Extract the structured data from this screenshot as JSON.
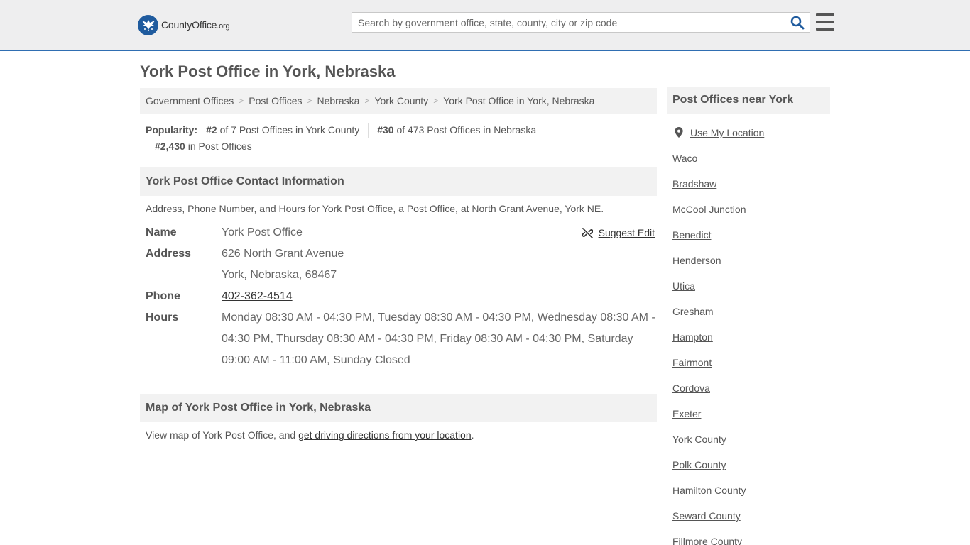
{
  "header": {
    "logo_text_main": "CountyOffice",
    "logo_text_tld": ".org",
    "search_placeholder": "Search by government office, state, county, city or zip code"
  },
  "page_title": "York Post Office in York, Nebraska",
  "breadcrumb": [
    "Government Offices",
    "Post Offices",
    "Nebraska",
    "York County",
    "York Post Office in York, Nebraska"
  ],
  "popularity": {
    "label": "Popularity:",
    "county_rank": "#2",
    "county_text": "of 7 Post Offices in York County",
    "state_rank": "#30",
    "state_text": "of 473 Post Offices in Nebraska",
    "national_rank": "#2,430",
    "national_text": "in Post Offices"
  },
  "contact": {
    "heading": "York Post Office Contact Information",
    "intro": "Address, Phone Number, and Hours for York Post Office, a Post Office, at North Grant Avenue, York NE.",
    "suggest_edit": "Suggest Edit",
    "name_label": "Name",
    "name": "York Post Office",
    "address_label": "Address",
    "address_line1": "626 North Grant Avenue",
    "address_line2": "York, Nebraska, 68467",
    "phone_label": "Phone",
    "phone": "402-362-4514",
    "hours_label": "Hours",
    "hours": "Monday 08:30 AM - 04:30 PM, Tuesday 08:30 AM - 04:30 PM, Wednesday 08:30 AM - 04:30 PM, Thursday 08:30 AM - 04:30 PM, Friday 08:30 AM - 04:30 PM, Saturday 09:00 AM - 11:00 AM, Sunday Closed"
  },
  "map": {
    "heading": "Map of York Post Office in York, Nebraska",
    "intro_before": "View map of York Post Office, and ",
    "intro_link": "get driving directions from your location",
    "intro_after": "."
  },
  "sidebar": {
    "heading": "Post Offices near York",
    "use_location": "Use My Location",
    "items": [
      "Waco",
      "Bradshaw",
      "McCool Junction",
      "Benedict",
      "Henderson",
      "Utica",
      "Gresham",
      "Hampton",
      "Fairmont",
      "Cordova",
      "Exeter",
      "York County",
      "Polk County",
      "Hamilton County",
      "Seward County",
      "Fillmore County"
    ]
  },
  "colors": {
    "accent": "#2f6eb2",
    "logo_blue": "#1f5b9e",
    "header_bg": "#eeeeef",
    "panel_bg": "#f2f2f2"
  },
  "icons": [
    "eagle-seal-icon",
    "search-icon",
    "hamburger-menu-icon",
    "broken-link-edit-icon",
    "location-pin-icon"
  ]
}
